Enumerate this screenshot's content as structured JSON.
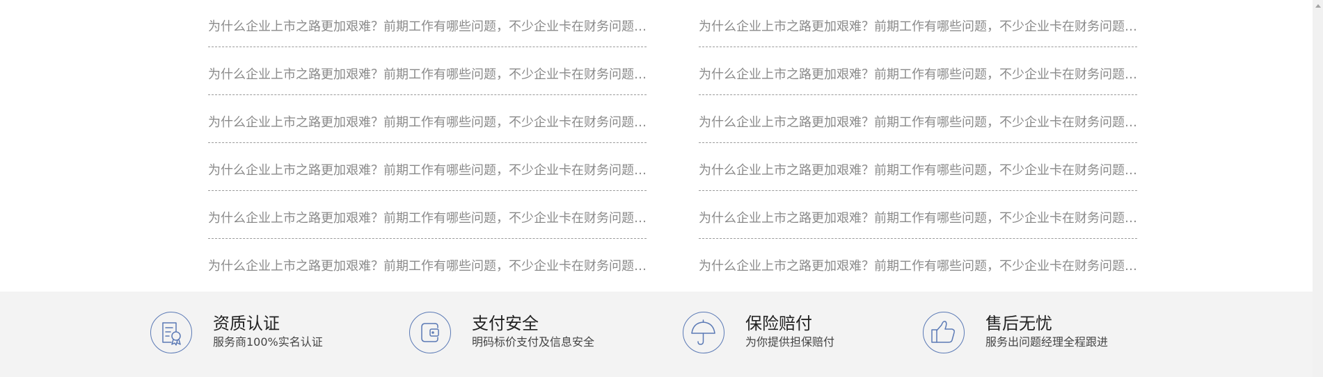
{
  "news": {
    "left": [
      {
        "title": "为什么企业上市之路更加艰难？前期工作有哪些问题，不少企业卡在财务问题上..."
      },
      {
        "title": "为什么企业上市之路更加艰难？前期工作有哪些问题，不少企业卡在财务问题上..."
      },
      {
        "title": "为什么企业上市之路更加艰难？前期工作有哪些问题，不少企业卡在财务问题上..."
      },
      {
        "title": "为什么企业上市之路更加艰难？前期工作有哪些问题，不少企业卡在财务问题上..."
      },
      {
        "title": "为什么企业上市之路更加艰难？前期工作有哪些问题，不少企业卡在财务问题上..."
      },
      {
        "title": "为什么企业上市之路更加艰难？前期工作有哪些问题，不少企业卡在财务问题上..."
      }
    ],
    "right": [
      {
        "title": "为什么企业上市之路更加艰难？前期工作有哪些问题，不少企业卡在财务问题上..."
      },
      {
        "title": "为什么企业上市之路更加艰难？前期工作有哪些问题，不少企业卡在财务问题上..."
      },
      {
        "title": "为什么企业上市之路更加艰难？前期工作有哪些问题，不少企业卡在财务问题上..."
      },
      {
        "title": "为什么企业上市之路更加艰难？前期工作有哪些问题，不少企业卡在财务问题上..."
      },
      {
        "title": "为什么企业上市之路更加艰难？前期工作有哪些问题，不少企业卡在财务问题上..."
      },
      {
        "title": "为什么企业上市之路更加艰难？前期工作有哪些问题，不少企业卡在财务问题上..."
      }
    ]
  },
  "features": [
    {
      "icon": "certificate-icon",
      "title": "资质认证",
      "desc": "服务商100%实名认证"
    },
    {
      "icon": "wallet-icon",
      "title": "支付安全",
      "desc": "明码标价支付及信息安全"
    },
    {
      "icon": "umbrella-icon",
      "title": "保险赔付",
      "desc": "为你提供担保赔付"
    },
    {
      "icon": "thumbs-up-icon",
      "title": "售后无忧",
      "desc": "服务出问题经理全程跟进"
    }
  ],
  "colors": {
    "news_text": "#8a8a8a",
    "divider": "#9a9a9a",
    "feature_bg": "#f3f3f3",
    "icon_stroke": "#5a79b5",
    "feature_title": "#222222",
    "feature_desc": "#444444"
  }
}
